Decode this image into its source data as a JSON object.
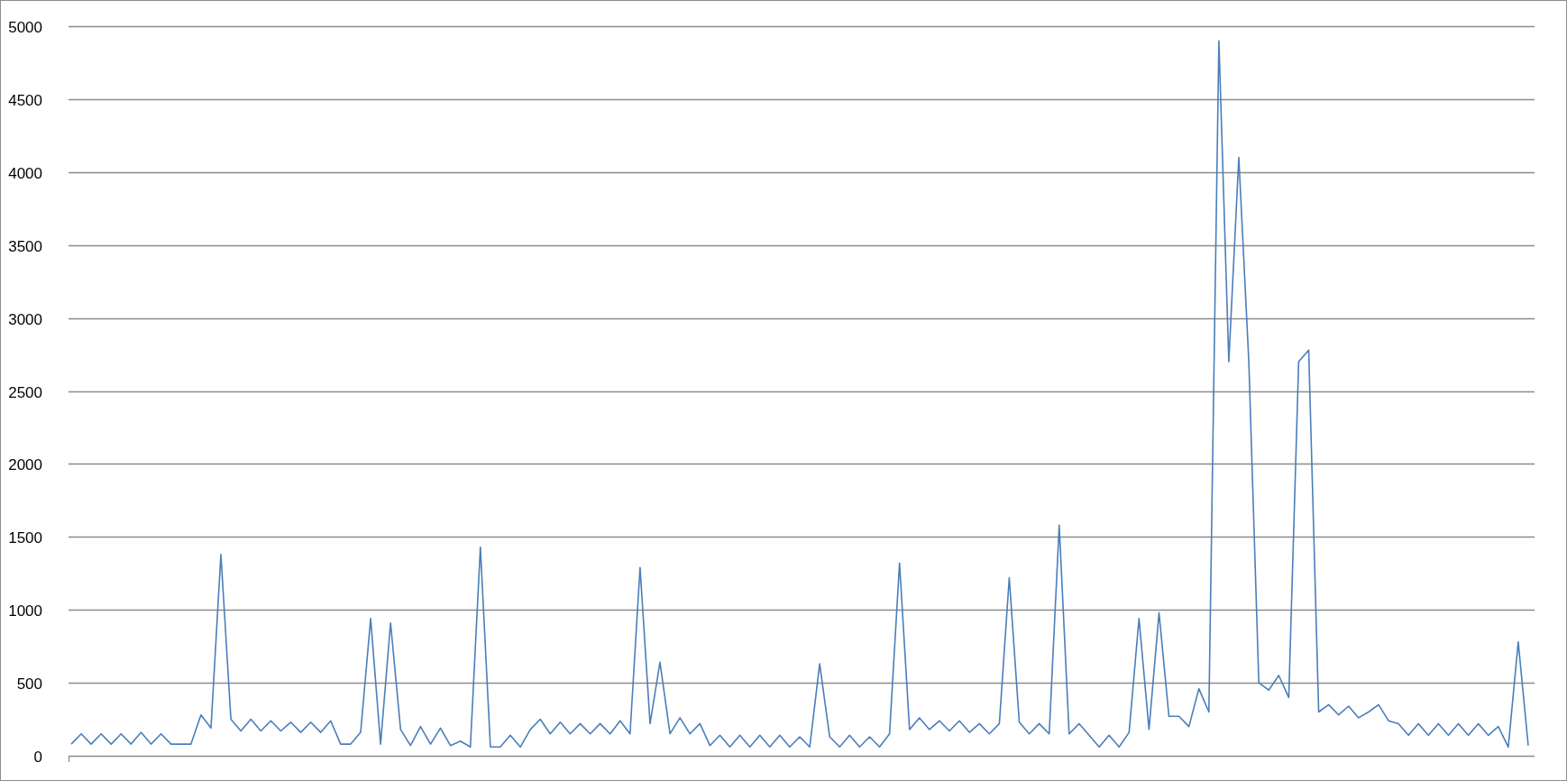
{
  "chart_data": {
    "type": "line",
    "grid": true,
    "ylim": [
      0,
      5000
    ],
    "yticks": [
      0,
      500,
      1000,
      1500,
      2000,
      2500,
      3000,
      3500,
      4000,
      4500,
      5000
    ],
    "series": [
      {
        "color": "#4a7ebb",
        "values": [
          80,
          150,
          80,
          150,
          80,
          150,
          80,
          160,
          80,
          150,
          80,
          80,
          80,
          280,
          190,
          1380,
          250,
          170,
          250,
          170,
          240,
          170,
          230,
          160,
          230,
          160,
          240,
          80,
          80,
          160,
          940,
          80,
          910,
          180,
          70,
          200,
          80,
          190,
          70,
          100,
          60,
          1430,
          60,
          60,
          140,
          60,
          180,
          250,
          150,
          230,
          150,
          220,
          150,
          220,
          150,
          240,
          150,
          1290,
          220,
          640,
          150,
          260,
          150,
          220,
          70,
          140,
          60,
          140,
          60,
          140,
          60,
          140,
          60,
          130,
          60,
          630,
          130,
          60,
          140,
          60,
          130,
          60,
          150,
          1320,
          180,
          260,
          180,
          240,
          170,
          240,
          160,
          220,
          150,
          220,
          1220,
          230,
          150,
          220,
          150,
          1580,
          150,
          220,
          140,
          60,
          140,
          60,
          160,
          940,
          180,
          980,
          270,
          270,
          200,
          460,
          300,
          4900,
          2700,
          4100,
          2700,
          500,
          450,
          550,
          400,
          2700,
          2780,
          300,
          350,
          280,
          340,
          260,
          300,
          350,
          240,
          220,
          140,
          220,
          140,
          220,
          140,
          220,
          140,
          220,
          140,
          200,
          60,
          780,
          70
        ]
      }
    ]
  }
}
